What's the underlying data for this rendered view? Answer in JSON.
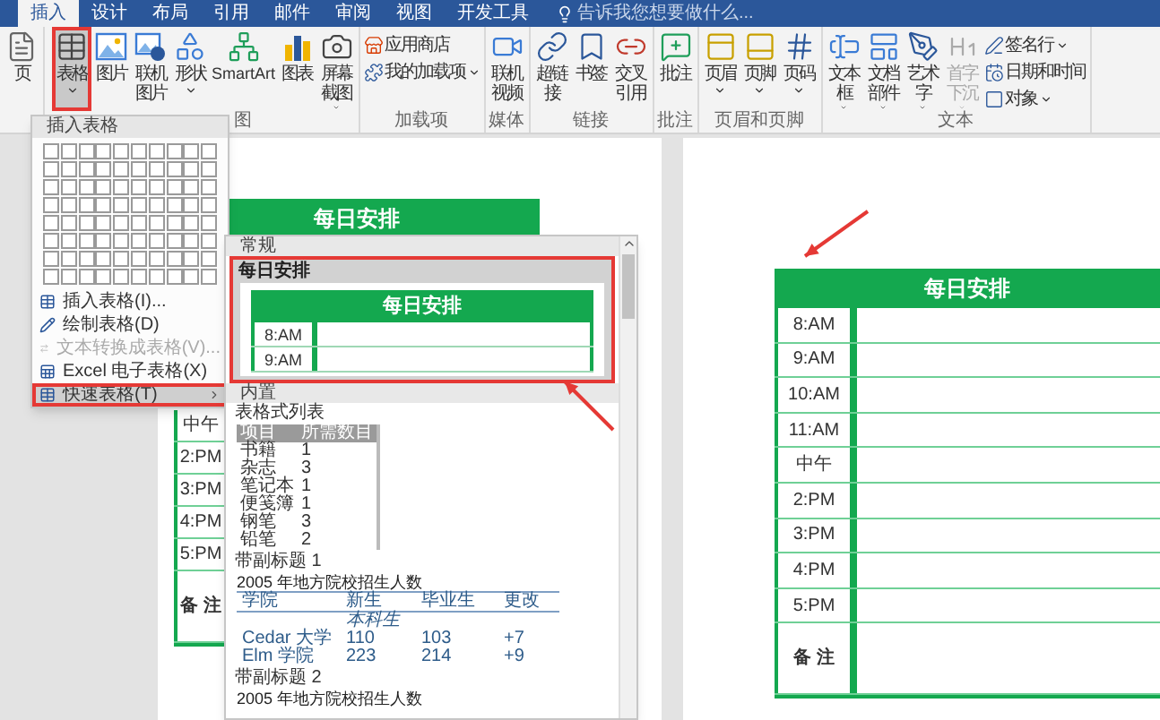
{
  "tabs": [
    {
      "label": "插入",
      "selected": true
    },
    {
      "label": "设计",
      "selected": false
    },
    {
      "label": "布局",
      "selected": false
    },
    {
      "label": "引用",
      "selected": false
    },
    {
      "label": "邮件",
      "selected": false
    },
    {
      "label": "审阅",
      "selected": false
    },
    {
      "label": "视图",
      "selected": false
    },
    {
      "label": "开发工具",
      "selected": false
    }
  ],
  "search": {
    "placeholder": "告诉我您想要做什么..."
  },
  "ribbon": {
    "groups": [
      {
        "buttons": [
          {
            "kind": "large",
            "label": "页",
            "selected": false,
            "disabled": false,
            "dropdown": false
          }
        ]
      },
      {
        "label": "图",
        "buttons": [
          {
            "kind": "large",
            "label": "表格",
            "selected": true,
            "disabled": false,
            "dropdown": true
          },
          {
            "kind": "large",
            "label": "图片",
            "selected": false,
            "disabled": false,
            "dropdown": false
          },
          {
            "kind": "large",
            "label": "联机图片",
            "selected": false,
            "disabled": false,
            "dropdown": false
          },
          {
            "kind": "large",
            "label": "形状",
            "selected": false,
            "disabled": false,
            "dropdown": true
          },
          {
            "kind": "large",
            "label": "SmartArt",
            "selected": false,
            "disabled": false,
            "dropdown": false
          },
          {
            "kind": "large",
            "label": "图表",
            "selected": false,
            "disabled": false,
            "dropdown": false
          },
          {
            "kind": "large",
            "label": "屏幕截图",
            "selected": false,
            "disabled": false,
            "dropdown": true
          }
        ]
      },
      {
        "label": "加载项",
        "buttons": [
          {
            "kind": "small",
            "label": "应用商店",
            "selected": false,
            "disabled": false,
            "dropdown": false
          },
          {
            "kind": "small",
            "label": "我的加载项",
            "selected": false,
            "disabled": false,
            "dropdown": true
          }
        ]
      },
      {
        "label": "媒体",
        "buttons": [
          {
            "kind": "large",
            "label": "联机视频",
            "selected": false,
            "disabled": false,
            "dropdown": false
          }
        ]
      },
      {
        "label": "链接",
        "buttons": [
          {
            "kind": "large",
            "label": "超链接",
            "selected": false,
            "disabled": false,
            "dropdown": false
          },
          {
            "kind": "large",
            "label": "书签",
            "selected": false,
            "disabled": false,
            "dropdown": false
          },
          {
            "kind": "large",
            "label": "交叉引用",
            "selected": false,
            "disabled": false,
            "dropdown": false
          }
        ]
      },
      {
        "label": "批注",
        "buttons": [
          {
            "kind": "large",
            "label": "批注",
            "selected": false,
            "disabled": false,
            "dropdown": false
          }
        ]
      },
      {
        "label": "页眉和页脚",
        "buttons": [
          {
            "kind": "large",
            "label": "页眉",
            "selected": false,
            "disabled": false,
            "dropdown": true
          },
          {
            "kind": "large",
            "label": "页脚",
            "selected": false,
            "disabled": false,
            "dropdown": true
          },
          {
            "kind": "large",
            "label": "页码",
            "selected": false,
            "disabled": false,
            "dropdown": true
          }
        ]
      },
      {
        "label": "文本",
        "buttons": [
          {
            "kind": "large",
            "label": "文本框",
            "selected": false,
            "disabled": false,
            "dropdown": true
          },
          {
            "kind": "large",
            "label": "文档部件",
            "selected": false,
            "disabled": false,
            "dropdown": true
          },
          {
            "kind": "large",
            "label": "艺术字",
            "selected": false,
            "disabled": false,
            "dropdown": true
          },
          {
            "kind": "large",
            "label": "首字下沉",
            "selected": false,
            "disabled": true,
            "dropdown": true
          },
          {
            "kind": "small",
            "label": "签名行",
            "selected": false,
            "disabled": false,
            "dropdown": true
          },
          {
            "kind": "small",
            "label": "日期和时间",
            "selected": false,
            "disabled": false,
            "dropdown": false
          },
          {
            "kind": "small",
            "label": "对象",
            "selected": false,
            "disabled": false,
            "dropdown": true
          }
        ]
      }
    ]
  },
  "table_menu": {
    "header": "插入表格",
    "items": [
      {
        "label": "插入表格(I)...",
        "selected": false,
        "disabled": false,
        "submenu": false
      },
      {
        "label": "绘制表格(D)",
        "selected": false,
        "disabled": false,
        "submenu": false
      },
      {
        "label": "文本转换成表格(V)...",
        "selected": false,
        "disabled": true,
        "submenu": false
      },
      {
        "label": "Excel 电子表格(X)",
        "selected": false,
        "disabled": false,
        "submenu": false
      },
      {
        "label": "快速表格(T)",
        "selected": true,
        "disabled": false,
        "submenu": true
      }
    ]
  },
  "quick_tables": {
    "sections": [
      {
        "header": "常规",
        "items": [
          {
            "kind": "schedule",
            "label": "每日安排",
            "selected": true,
            "title": "每日安排",
            "rows": [
              "8:AM",
              "9:AM"
            ]
          }
        ]
      },
      {
        "header": "内置",
        "items": [
          {
            "kind": "list",
            "label": "表格式列表",
            "selected": false,
            "columns": [
              "项目",
              "所需数目"
            ],
            "rows": [
              [
                "书籍",
                "1"
              ],
              [
                "杂志",
                "3"
              ],
              [
                "笔记本",
                "1"
              ],
              [
                "便笺簿",
                "1"
              ],
              [
                "钢笔",
                "3"
              ],
              [
                "铅笔",
                "2"
              ]
            ]
          },
          {
            "kind": "subheads",
            "label": "带副标题 1",
            "selected": false,
            "caption": "2005 年地方院校招生人数",
            "columns": [
              "学院",
              "新生",
              "毕业生",
              "更改"
            ],
            "subhead": "本科生",
            "rows": [
              [
                "Cedar 大学",
                "110",
                "103",
                "+7"
              ],
              [
                "Elm 学院",
                "223",
                "214",
                "+9"
              ]
            ]
          },
          {
            "kind": "subheads",
            "label": "带副标题 2",
            "selected": false,
            "caption": "2005 年地方院校招生人数"
          }
        ]
      }
    ]
  },
  "document": {
    "pages": [
      {
        "title": "每日安排",
        "rows": [
          {
            "kind": "time",
            "label": "中午"
          },
          {
            "kind": "time",
            "label": "2:PM"
          },
          {
            "kind": "time",
            "label": "3:PM"
          },
          {
            "kind": "time",
            "label": "4:PM"
          },
          {
            "kind": "time",
            "label": "5:PM"
          },
          {
            "kind": "notes",
            "label": "备 注"
          }
        ]
      },
      {
        "title": "每日安排",
        "rows": [
          {
            "kind": "time",
            "label": "8:AM"
          },
          {
            "kind": "time",
            "label": "9:AM"
          },
          {
            "kind": "time",
            "label": "10:AM"
          },
          {
            "kind": "time",
            "label": "11:AM"
          },
          {
            "kind": "time",
            "label": "中午"
          },
          {
            "kind": "time",
            "label": "2:PM"
          },
          {
            "kind": "time",
            "label": "3:PM"
          },
          {
            "kind": "time",
            "label": "4:PM"
          },
          {
            "kind": "time",
            "label": "5:PM"
          },
          {
            "kind": "notes",
            "label": "备 注"
          }
        ]
      }
    ]
  }
}
